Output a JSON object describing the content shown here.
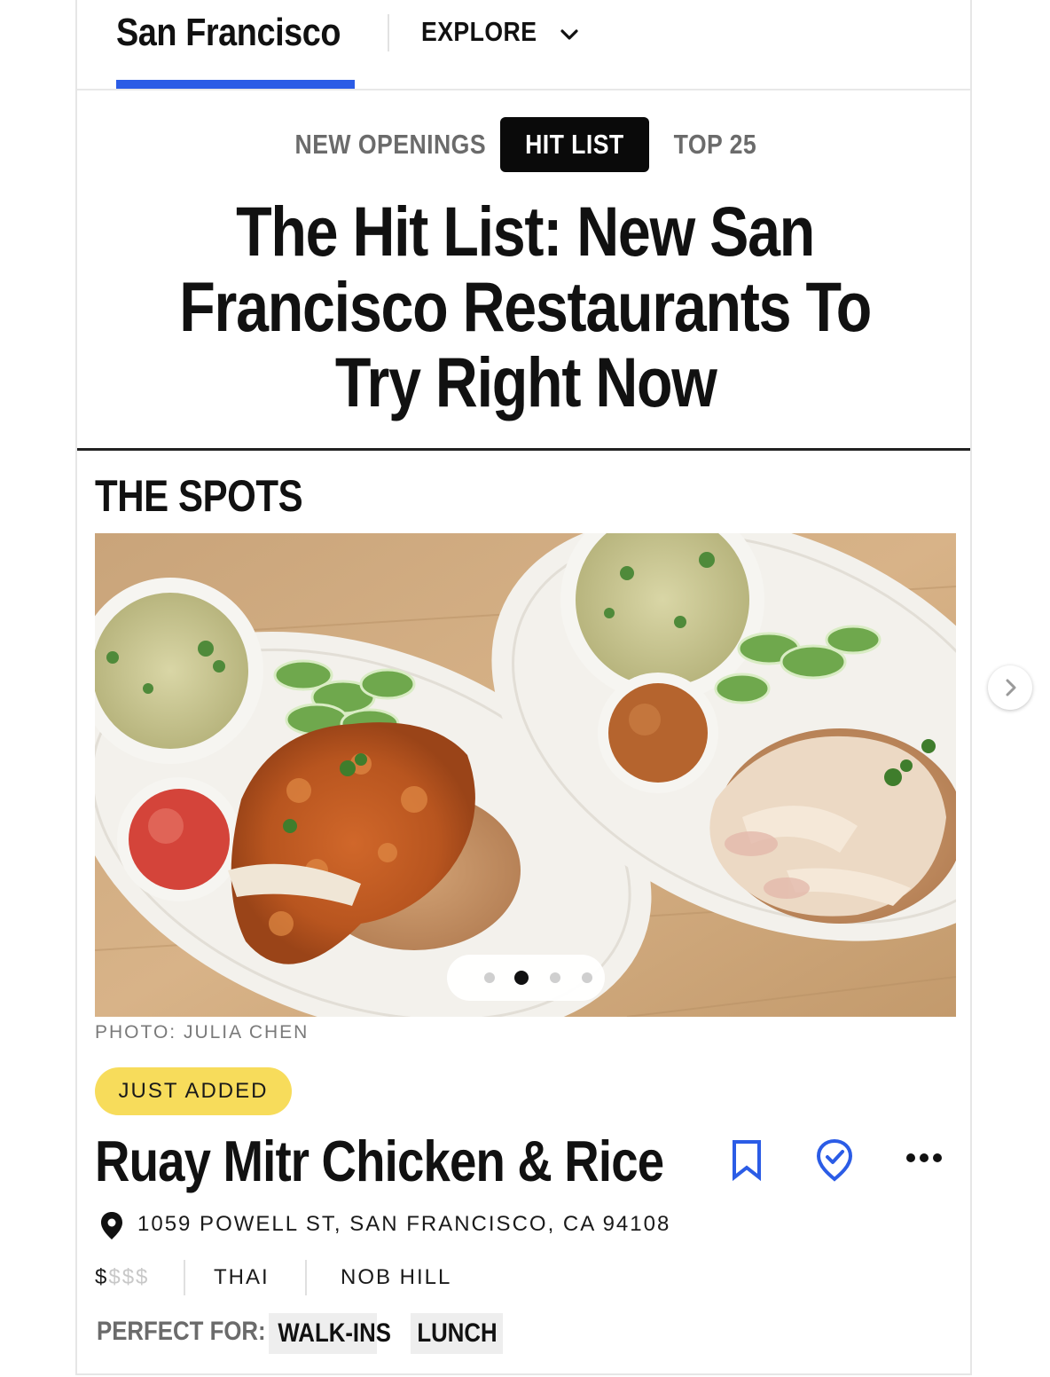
{
  "nav": {
    "city": "San Francisco",
    "explore_label": "EXPLORE"
  },
  "tabs": [
    {
      "label": "NEW OPENINGS",
      "active": false
    },
    {
      "label": "HIT LIST",
      "active": true
    },
    {
      "label": "TOP 25",
      "active": false
    }
  ],
  "headline": {
    "line1": "The Hit List: New San",
    "line2": "Francisco Restaurants To",
    "line3": "Try Right Now"
  },
  "section_title": "THE SPOTS",
  "photo": {
    "credit": "PHOTO: JULIA CHEN",
    "carousel_count": 4,
    "carousel_active_index": 1
  },
  "listing": {
    "badge": "JUST ADDED",
    "name": "Ruay Mitr Chicken & Rice",
    "address": "1059 POWELL ST, SAN FRANCISCO, CA 94108",
    "price_active": "$",
    "price_inactive": "$$$",
    "cuisine": "THAI",
    "neighborhood": "NOB HILL",
    "perfect_for_label": "PERFECT FOR:",
    "perfect_for": [
      "WALK-INS",
      "LUNCH"
    ]
  },
  "colors": {
    "accent_blue": "#2b5ce6",
    "badge_yellow": "#f7dc5b",
    "tab_active_bg": "#0a0a0a"
  },
  "icons": {
    "explore": "chevron-down-icon",
    "bookmark": "bookmark-icon",
    "check": "check-badge-icon",
    "more": "more-icon",
    "location": "location-pin-icon",
    "next": "chevron-right-icon"
  }
}
